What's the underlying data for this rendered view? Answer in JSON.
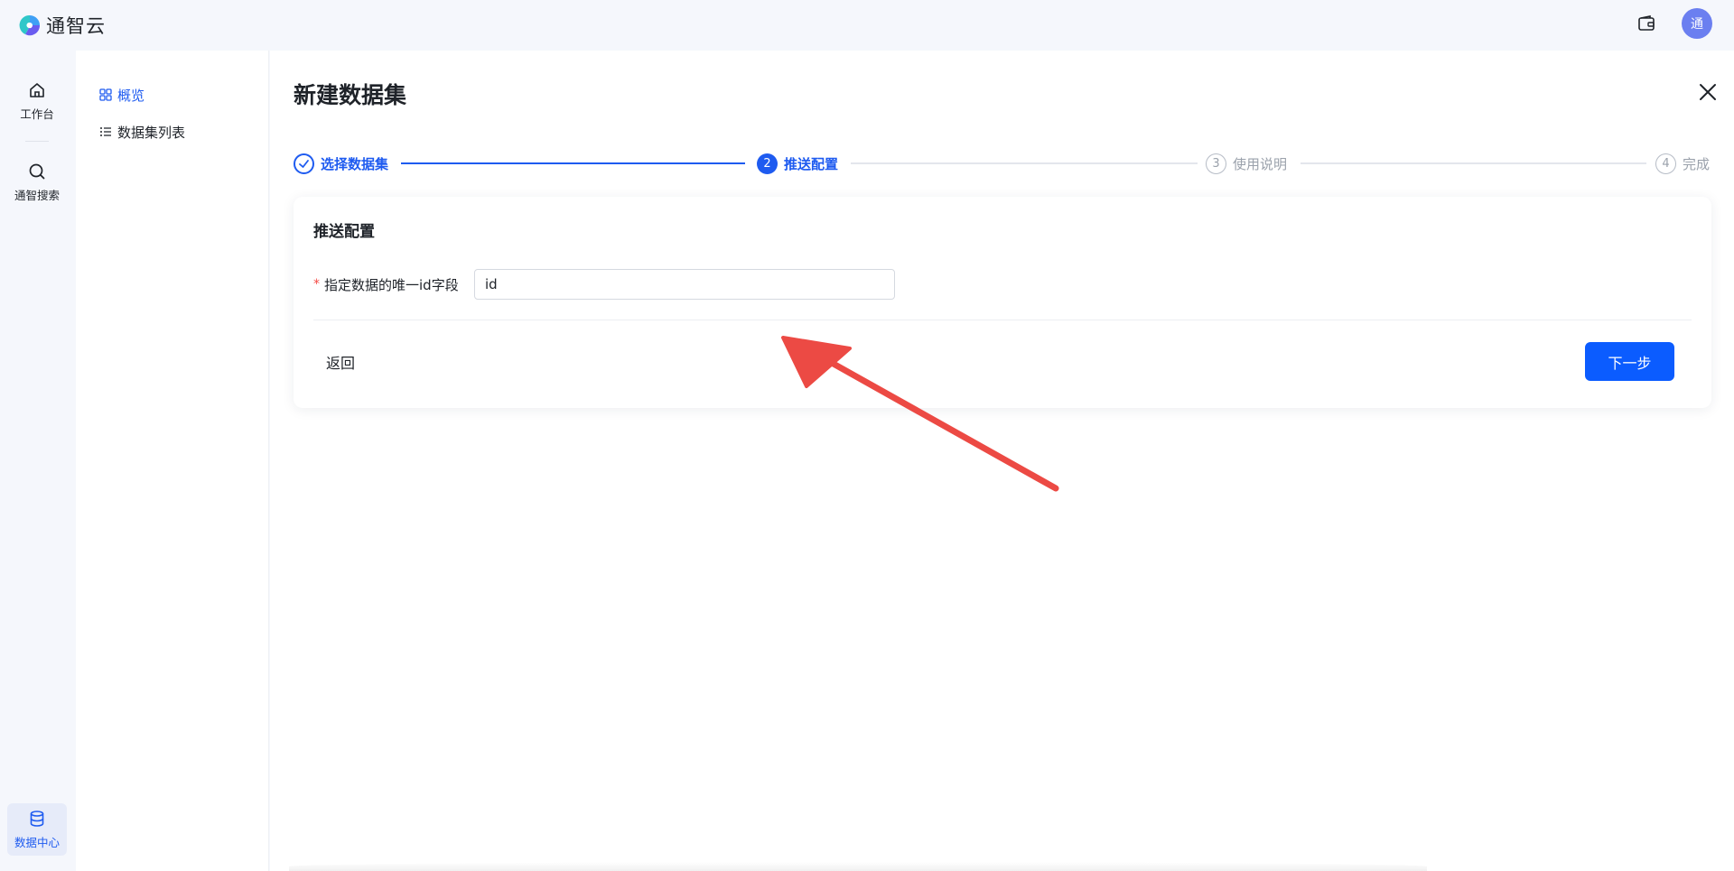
{
  "app": {
    "name": "通智云",
    "avatar_text": "通"
  },
  "rail": {
    "items": [
      {
        "label": "工作台",
        "icon": "home-icon"
      },
      {
        "label": "通智搜索",
        "icon": "search-icon"
      },
      {
        "label": "数据中心",
        "icon": "database-icon"
      }
    ]
  },
  "subnav": {
    "items": [
      {
        "label": "概览",
        "icon": "grid-icon"
      },
      {
        "label": "数据集列表",
        "icon": "list-icon"
      }
    ]
  },
  "page": {
    "title": "新建数据集"
  },
  "steps": [
    {
      "index": "1",
      "label": "选择数据集",
      "state": "done"
    },
    {
      "index": "2",
      "label": "推送配置",
      "state": "current"
    },
    {
      "index": "3",
      "label": "使用说明",
      "state": "todo"
    },
    {
      "index": "4",
      "label": "完成",
      "state": "todo"
    }
  ],
  "card": {
    "title": "推送配置",
    "field": {
      "required_mark": "*",
      "label": "指定数据的唯一id字段",
      "value": "id"
    },
    "back_label": "返回",
    "next_label": "下一步"
  },
  "colors": {
    "primary": "#0b5cff",
    "accent_text": "#1e5bf0",
    "arrow": "#ec4a44",
    "avatar_bg": "#6b7ff0"
  }
}
